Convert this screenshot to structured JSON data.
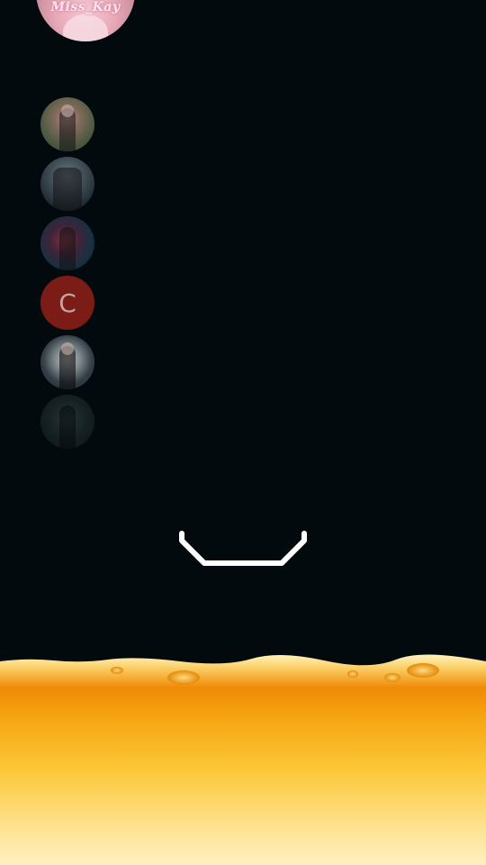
{
  "top_avatar": {
    "name_text": "Miss_Kay"
  },
  "avatars": [
    {
      "label": ""
    },
    {
      "label": ""
    },
    {
      "label": ""
    },
    {
      "label": "C"
    },
    {
      "label": ""
    },
    {
      "label": ""
    }
  ],
  "colors": {
    "background": "#020a0e",
    "smile_stroke": "#ffffff",
    "fire_top": "#fff2b8",
    "fire_mid": "#f59a0a",
    "fire_bottom": "#fde4a0",
    "letter_avatar": "#8a1e18"
  }
}
